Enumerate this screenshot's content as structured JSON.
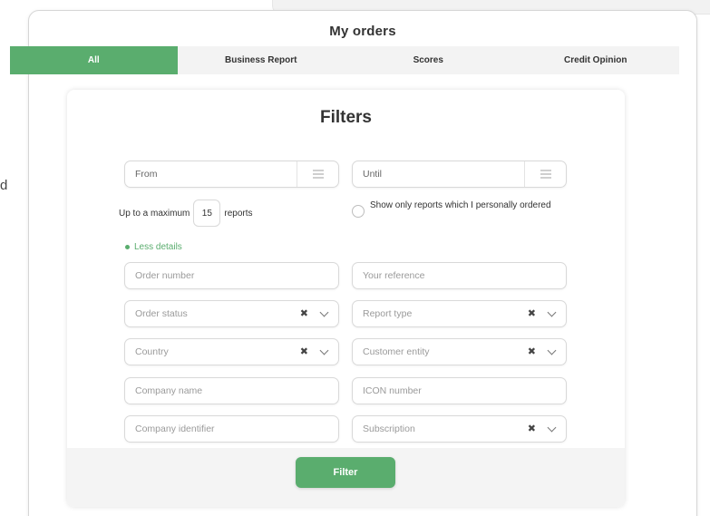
{
  "background": {
    "edge_text": "d"
  },
  "header": {
    "title": "My orders"
  },
  "tabs": [
    {
      "label": "All",
      "active": true
    },
    {
      "label": "Business Report",
      "active": false
    },
    {
      "label": "Scores",
      "active": false
    },
    {
      "label": "Credit Opinion",
      "active": false
    }
  ],
  "filters": {
    "title": "Filters",
    "from_label": "From",
    "until_label": "Until",
    "max_prefix": "Up to a maximum",
    "max_value": "15",
    "max_suffix": "reports",
    "personal_only_label": "Show only reports which I personally ordered",
    "less_details_label": "Less details",
    "fields": {
      "order_number": "Order number",
      "your_reference": "Your reference",
      "order_status": "Order status",
      "report_type": "Report type",
      "country": "Country",
      "customer_entity": "Customer entity",
      "company_name": "Company name",
      "icon_number": "ICON number",
      "company_identifier": "Company identifier",
      "subscription": "Subscription"
    },
    "filter_button": "Filter"
  },
  "icons": {
    "calendar": "calendar-icon",
    "clear": "clear-icon",
    "chevron": "chevron-down-icon",
    "bullet": "dot-icon"
  },
  "colors": {
    "accent": "#5aad6e",
    "tab_bar": "#f3f3f3",
    "band": "#f4f4f4"
  }
}
